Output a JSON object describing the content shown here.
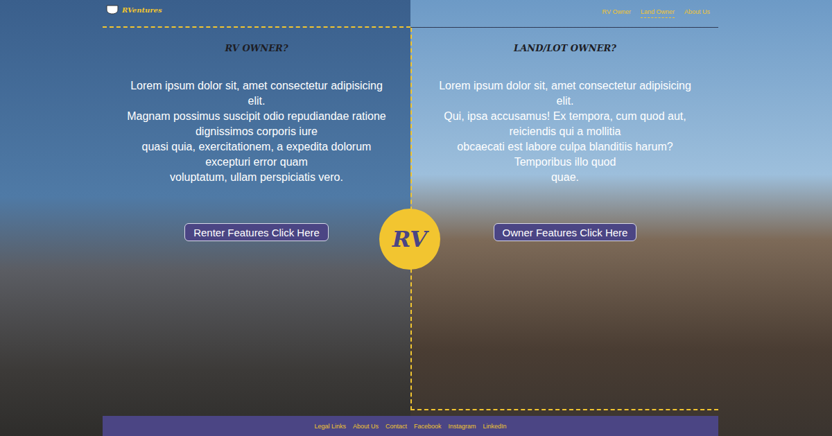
{
  "logo": {
    "text": "RVentures"
  },
  "nav": [
    {
      "label": "RV Owner",
      "selected": false
    },
    {
      "label": "Land Owner",
      "selected": true
    },
    {
      "label": "About Us",
      "selected": false
    }
  ],
  "panels": [
    {
      "title": "RV OWNER?",
      "lines": [
        "Lorem ipsum dolor sit, amet consectetur adipisicing",
        "elit.",
        "Magnam possimus suscipit odio repudiandae ratione",
        "dignissimos corporis iure",
        "quasi quia, exercitationem, a expedita dolorum",
        "excepturi error quam",
        "voluptatum, ullam perspiciatis vero."
      ],
      "button": "Renter Features Click Here"
    },
    {
      "title": "LAND/LOT OWNER?",
      "lines": [
        "Lorem ipsum dolor sit, amet consectetur adipisicing",
        "elit.",
        "Qui, ipsa accusamus! Ex tempora, cum quod aut,",
        "reiciendis qui a mollitia",
        "obcaecati est labore culpa blanditiis harum?",
        "Temporibus illo quod",
        "quae."
      ],
      "button": "Owner Features Click Here"
    }
  ],
  "badge": "RV",
  "footer": {
    "links": [
      "Legal Links",
      "About Us",
      "Contact",
      "Facebook",
      "Instagram",
      "LinkedIn"
    ]
  }
}
